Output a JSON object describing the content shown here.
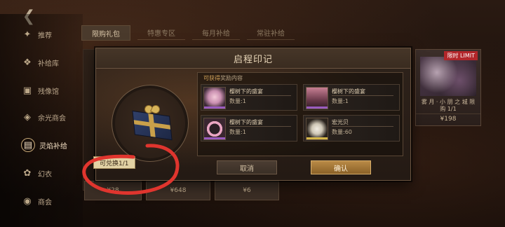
{
  "back_icon": "back-arrow-icon",
  "sidebar": {
    "items": [
      {
        "label": "推荐",
        "icon": "recommend-icon"
      },
      {
        "label": "补给库",
        "icon": "supply-icon"
      },
      {
        "label": "残像馆",
        "icon": "gallery-icon"
      },
      {
        "label": "余光商会",
        "icon": "shop-icon"
      },
      {
        "label": "灵焰补给",
        "icon": "gift-icon",
        "active": true
      },
      {
        "label": "幻衣",
        "icon": "outfit-icon"
      },
      {
        "label": "商会",
        "icon": "chamber-icon"
      }
    ]
  },
  "tabs": [
    {
      "label": "限购礼包",
      "active": true
    },
    {
      "label": "特惠专区"
    },
    {
      "label": "每月补给"
    },
    {
      "label": "常驻补给"
    }
  ],
  "right_card": {
    "badge": "限时 LIMIT",
    "name": "雾 月 · 小 朋 之 城\n限购 1/1",
    "price": "¥198"
  },
  "bottom_cards": [
    {
      "label": "¥28"
    },
    {
      "label": "¥648"
    },
    {
      "label": "¥6"
    }
  ],
  "dialog": {
    "title": "启程印记",
    "rewards_title_hl": "可获得",
    "rewards_title": "奖励内容",
    "redeem_tag": "可兑换1/1",
    "items": [
      {
        "label": "樱树下的盛宴",
        "qty": "数量:1",
        "rarity_color": "#9a5cc0"
      },
      {
        "label": "樱树下的盛宴",
        "qty": "数量:1",
        "rarity_color": "#9a5cc0"
      },
      {
        "label": "樱树下的盛宴",
        "qty": "数量:1",
        "rarity_color": "#9a5cc0"
      },
      {
        "label": "宏光贝",
        "qty": "数量:60",
        "rarity_color": "#d6b74a"
      }
    ],
    "cancel": "取消",
    "confirm": "确认"
  },
  "colors": {
    "accent_gold": "#b98a46",
    "annotation_red": "#e0352e"
  }
}
